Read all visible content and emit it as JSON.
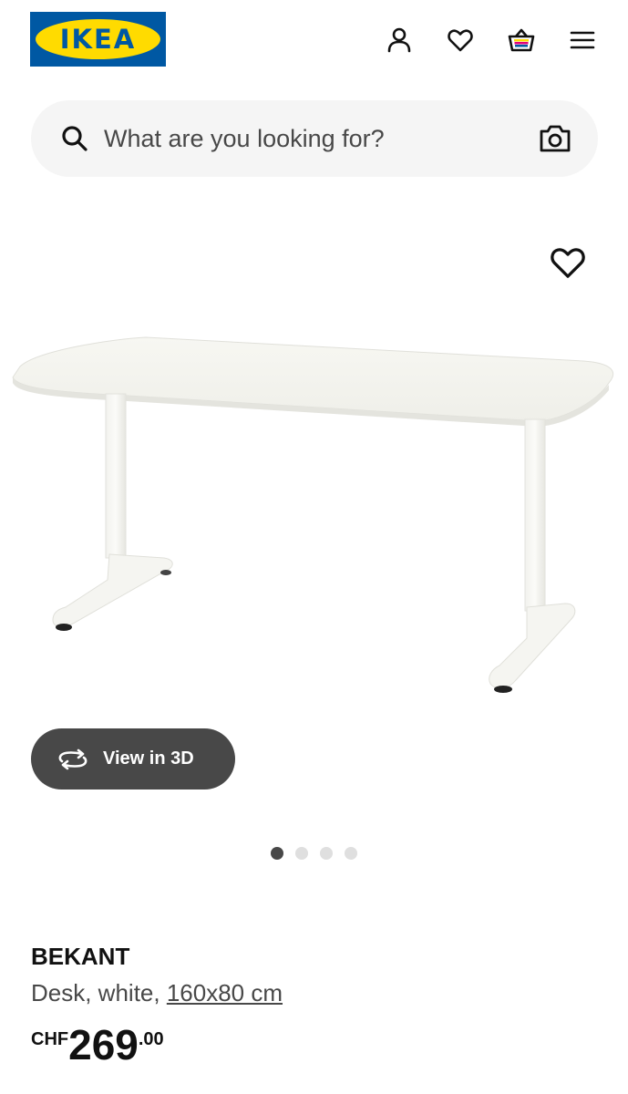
{
  "header": {
    "logo_text": "IKEA",
    "icons": [
      "user-icon",
      "heart-icon",
      "basket-icon",
      "menu-icon"
    ]
  },
  "search": {
    "placeholder": "What are you looking for?"
  },
  "product": {
    "name": "BEKANT",
    "description_prefix": "Desk, white, ",
    "measurement": "160x80 cm",
    "currency": "CHF",
    "price_integer": "269",
    "price_decimal": ".00",
    "view3d_label": "View in 3D",
    "image_count": 4,
    "active_image": 1
  },
  "colors": {
    "brand_blue": "#0058a3",
    "brand_yellow": "#ffdb00",
    "dark_button": "#484848",
    "search_bg": "#f5f5f5"
  }
}
